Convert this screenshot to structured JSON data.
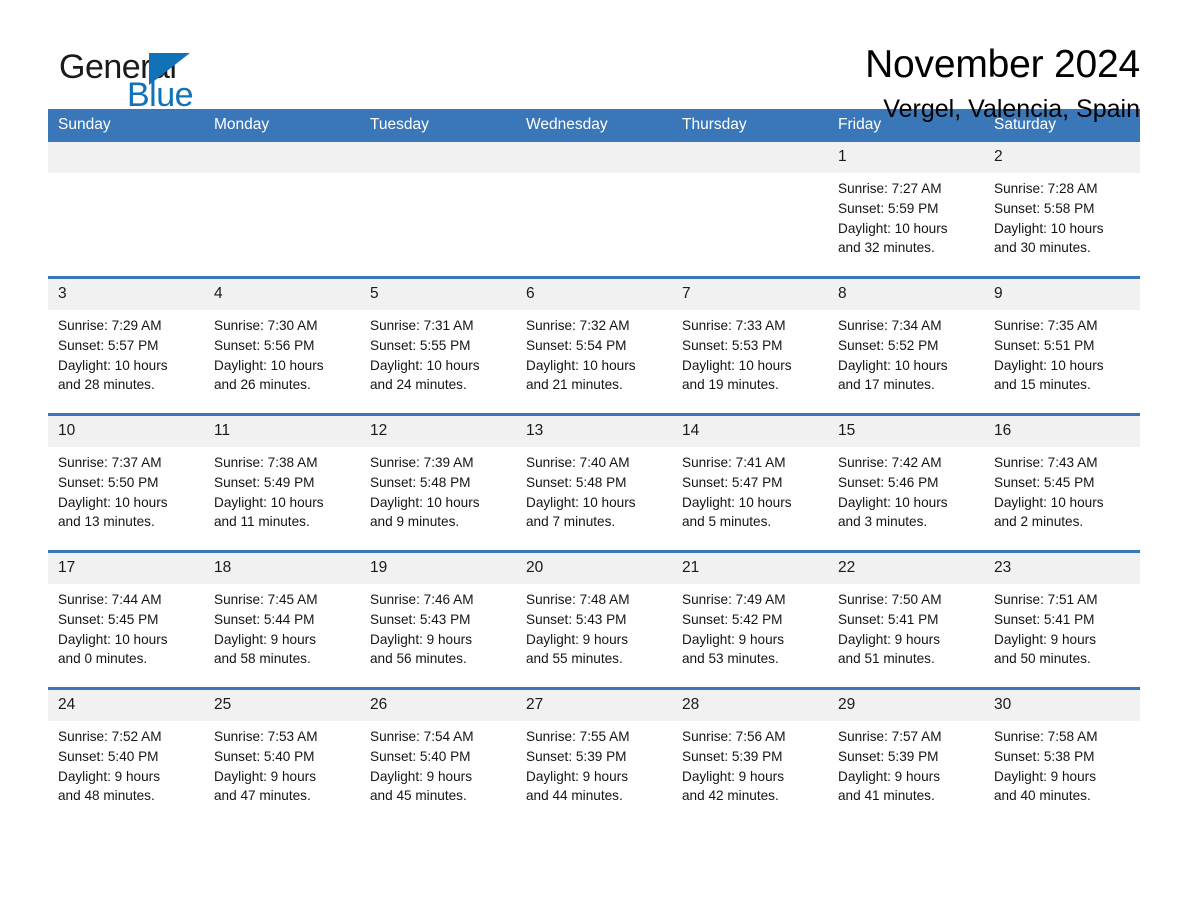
{
  "brand": {
    "word_one": "General",
    "word_two": "Blue",
    "triangle_icon": "triangle-logo-icon",
    "accent_color": "#1172b8"
  },
  "header": {
    "month_title": "November 2024",
    "location": "Vergel, Valencia, Spain"
  },
  "colors": {
    "header_blue": "#3a77b8",
    "row_divider_blue": "#3a77b8",
    "daynum_band": "#f1f1f1",
    "text": "#141414"
  },
  "weekday_headers": [
    "Sunday",
    "Monday",
    "Tuesday",
    "Wednesday",
    "Thursday",
    "Friday",
    "Saturday"
  ],
  "weeks": [
    [
      {
        "day": "",
        "info": ""
      },
      {
        "day": "",
        "info": ""
      },
      {
        "day": "",
        "info": ""
      },
      {
        "day": "",
        "info": ""
      },
      {
        "day": "",
        "info": ""
      },
      {
        "day": "1",
        "info": "Sunrise: 7:27 AM\nSunset: 5:59 PM\nDaylight: 10 hours\nand 32 minutes."
      },
      {
        "day": "2",
        "info": "Sunrise: 7:28 AM\nSunset: 5:58 PM\nDaylight: 10 hours\nand 30 minutes."
      }
    ],
    [
      {
        "day": "3",
        "info": "Sunrise: 7:29 AM\nSunset: 5:57 PM\nDaylight: 10 hours\nand 28 minutes."
      },
      {
        "day": "4",
        "info": "Sunrise: 7:30 AM\nSunset: 5:56 PM\nDaylight: 10 hours\nand 26 minutes."
      },
      {
        "day": "5",
        "info": "Sunrise: 7:31 AM\nSunset: 5:55 PM\nDaylight: 10 hours\nand 24 minutes."
      },
      {
        "day": "6",
        "info": "Sunrise: 7:32 AM\nSunset: 5:54 PM\nDaylight: 10 hours\nand 21 minutes."
      },
      {
        "day": "7",
        "info": "Sunrise: 7:33 AM\nSunset: 5:53 PM\nDaylight: 10 hours\nand 19 minutes."
      },
      {
        "day": "8",
        "info": "Sunrise: 7:34 AM\nSunset: 5:52 PM\nDaylight: 10 hours\nand 17 minutes."
      },
      {
        "day": "9",
        "info": "Sunrise: 7:35 AM\nSunset: 5:51 PM\nDaylight: 10 hours\nand 15 minutes."
      }
    ],
    [
      {
        "day": "10",
        "info": "Sunrise: 7:37 AM\nSunset: 5:50 PM\nDaylight: 10 hours\nand 13 minutes."
      },
      {
        "day": "11",
        "info": "Sunrise: 7:38 AM\nSunset: 5:49 PM\nDaylight: 10 hours\nand 11 minutes."
      },
      {
        "day": "12",
        "info": "Sunrise: 7:39 AM\nSunset: 5:48 PM\nDaylight: 10 hours\nand 9 minutes."
      },
      {
        "day": "13",
        "info": "Sunrise: 7:40 AM\nSunset: 5:48 PM\nDaylight: 10 hours\nand 7 minutes."
      },
      {
        "day": "14",
        "info": "Sunrise: 7:41 AM\nSunset: 5:47 PM\nDaylight: 10 hours\nand 5 minutes."
      },
      {
        "day": "15",
        "info": "Sunrise: 7:42 AM\nSunset: 5:46 PM\nDaylight: 10 hours\nand 3 minutes."
      },
      {
        "day": "16",
        "info": "Sunrise: 7:43 AM\nSunset: 5:45 PM\nDaylight: 10 hours\nand 2 minutes."
      }
    ],
    [
      {
        "day": "17",
        "info": "Sunrise: 7:44 AM\nSunset: 5:45 PM\nDaylight: 10 hours\nand 0 minutes."
      },
      {
        "day": "18",
        "info": "Sunrise: 7:45 AM\nSunset: 5:44 PM\nDaylight: 9 hours\nand 58 minutes."
      },
      {
        "day": "19",
        "info": "Sunrise: 7:46 AM\nSunset: 5:43 PM\nDaylight: 9 hours\nand 56 minutes."
      },
      {
        "day": "20",
        "info": "Sunrise: 7:48 AM\nSunset: 5:43 PM\nDaylight: 9 hours\nand 55 minutes."
      },
      {
        "day": "21",
        "info": "Sunrise: 7:49 AM\nSunset: 5:42 PM\nDaylight: 9 hours\nand 53 minutes."
      },
      {
        "day": "22",
        "info": "Sunrise: 7:50 AM\nSunset: 5:41 PM\nDaylight: 9 hours\nand 51 minutes."
      },
      {
        "day": "23",
        "info": "Sunrise: 7:51 AM\nSunset: 5:41 PM\nDaylight: 9 hours\nand 50 minutes."
      }
    ],
    [
      {
        "day": "24",
        "info": "Sunrise: 7:52 AM\nSunset: 5:40 PM\nDaylight: 9 hours\nand 48 minutes."
      },
      {
        "day": "25",
        "info": "Sunrise: 7:53 AM\nSunset: 5:40 PM\nDaylight: 9 hours\nand 47 minutes."
      },
      {
        "day": "26",
        "info": "Sunrise: 7:54 AM\nSunset: 5:40 PM\nDaylight: 9 hours\nand 45 minutes."
      },
      {
        "day": "27",
        "info": "Sunrise: 7:55 AM\nSunset: 5:39 PM\nDaylight: 9 hours\nand 44 minutes."
      },
      {
        "day": "28",
        "info": "Sunrise: 7:56 AM\nSunset: 5:39 PM\nDaylight: 9 hours\nand 42 minutes."
      },
      {
        "day": "29",
        "info": "Sunrise: 7:57 AM\nSunset: 5:39 PM\nDaylight: 9 hours\nand 41 minutes."
      },
      {
        "day": "30",
        "info": "Sunrise: 7:58 AM\nSunset: 5:38 PM\nDaylight: 9 hours\nand 40 minutes."
      }
    ]
  ]
}
